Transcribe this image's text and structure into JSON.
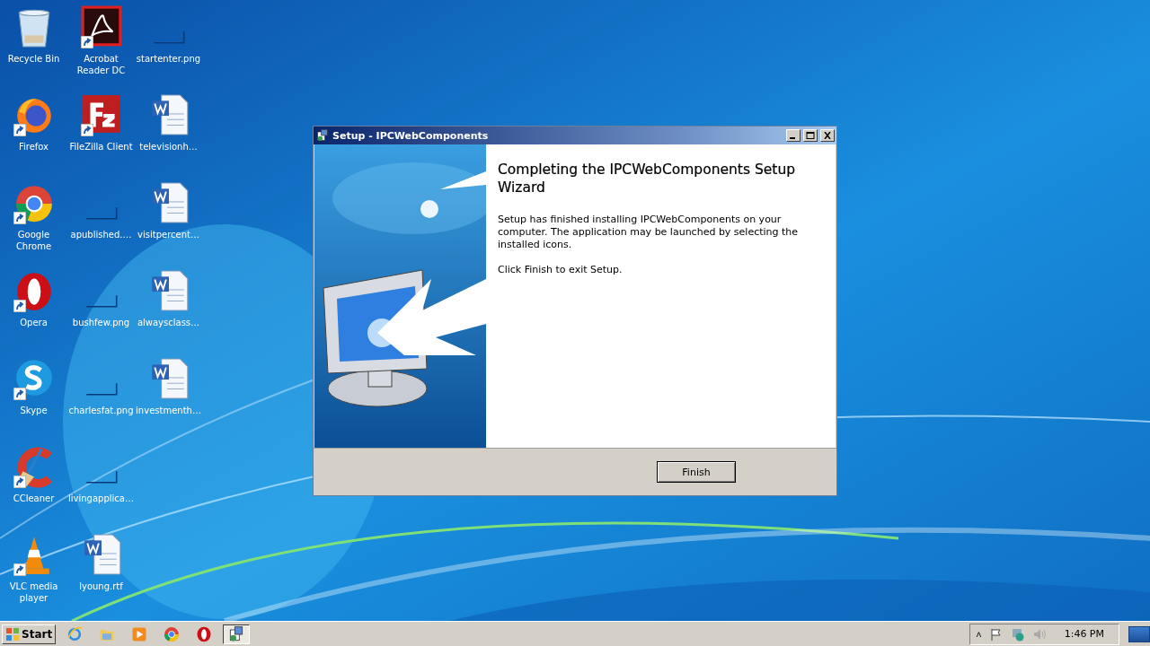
{
  "desktop_icons": [
    {
      "label": "Recycle Bin",
      "kind": "recycle",
      "shortcut": false
    },
    {
      "label": "Firefox",
      "kind": "firefox",
      "shortcut": true
    },
    {
      "label": "Google Chrome",
      "kind": "chrome",
      "shortcut": true
    },
    {
      "label": "Opera",
      "kind": "opera",
      "shortcut": true
    },
    {
      "label": "Skype",
      "kind": "skype",
      "shortcut": true
    },
    {
      "label": "CCleaner",
      "kind": "ccleaner",
      "shortcut": true
    },
    {
      "label": "VLC media player",
      "kind": "vlc",
      "shortcut": true
    },
    {
      "label": "Acrobat Reader DC",
      "kind": "acrobat",
      "shortcut": true
    },
    {
      "label": "FileZilla Client",
      "kind": "filezilla",
      "shortcut": true
    },
    {
      "label": "apublished.…",
      "shortcut": false
    },
    {
      "label": "bushfew.png",
      "shortcut": false
    },
    {
      "label": "charlesfat.png",
      "shortcut": false
    },
    {
      "label": "livingapplica…",
      "shortcut": false
    },
    {
      "label": "lyoung.rtf",
      "kind": "word",
      "shortcut": false
    },
    {
      "label": "startenter.png",
      "shortcut": false
    },
    {
      "label": "televisionh…",
      "kind": "word",
      "shortcut": false
    },
    {
      "label": "visitpercent…",
      "kind": "word",
      "shortcut": false
    },
    {
      "label": "alwaysclass…",
      "kind": "word",
      "shortcut": false
    },
    {
      "label": "investmenth…",
      "kind": "word",
      "shortcut": false
    }
  ],
  "window": {
    "title": "Setup - IPCWebComponents",
    "heading": "Completing the IPCWebComponents Setup Wizard",
    "paragraphs": [
      "Setup has finished installing IPCWebComponents on your computer. The application may be launched by selecting the installed icons.",
      "Click Finish to exit Setup."
    ],
    "button": "Finish"
  },
  "taskbar": {
    "start": "Start",
    "apps": [
      {
        "kind": "ie",
        "selected": false
      },
      {
        "kind": "folder",
        "selected": false
      },
      {
        "kind": "media",
        "selected": false
      },
      {
        "kind": "chrome",
        "selected": false
      },
      {
        "kind": "opera",
        "selected": false
      },
      {
        "kind": "setup",
        "selected": true
      }
    ],
    "tray_chevron": "˄",
    "clock": "1:46 PM"
  }
}
